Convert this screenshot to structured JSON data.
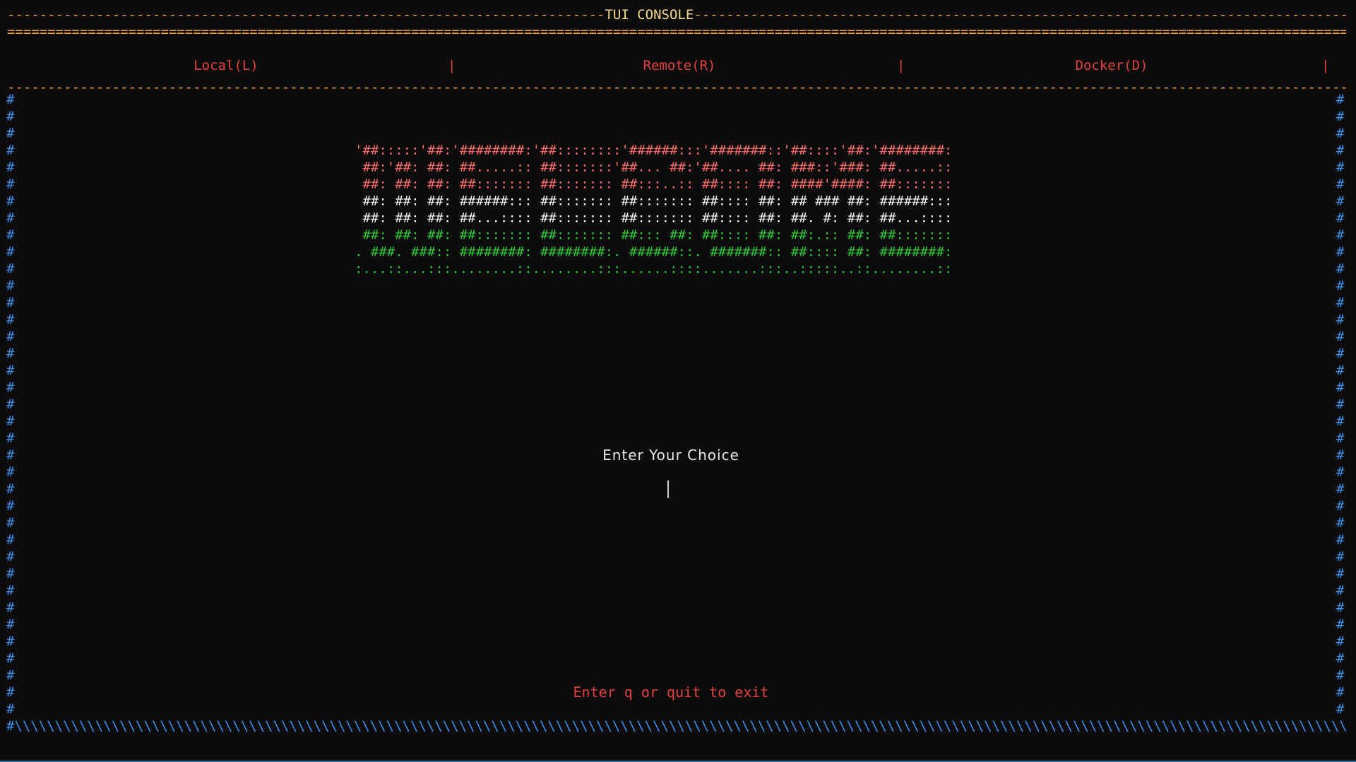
{
  "window": {
    "title": "TUI CONSOLE"
  },
  "menu": {
    "items": [
      {
        "label": "Local(L)"
      },
      {
        "label": "Remote(R)"
      },
      {
        "label": "Docker(D)"
      }
    ],
    "separator": "|"
  },
  "banner": {
    "lines": [
      "'##:::::'##:'########:'##::::::::'######:::'#######::'##::::'##:'########:",
      " ##:'##: ##: ##.....:: ##:::::::'##... ##:'##.... ##: ###::'###: ##.....::",
      " ##: ##: ##: ##::::::: ##::::::: ##:::..:: ##:::: ##: ####'####: ##:::::::",
      " ##: ##: ##: ######::: ##::::::: ##::::::: ##:::: ##: ## ### ##: ######:::",
      " ##: ##: ##: ##...:::: ##::::::: ##::::::: ##:::: ##: ##. #: ##: ##...::::",
      " ##: ##: ##: ##::::::: ##::::::: ##::: ##: ##:::: ##: ##:.:: ##: ##:::::::",
      ". ###. ###:: ########: ########:. ######::. #######:: ##:::: ##: ########:",
      ":...::...:::........::........:::......::::.......:::..:::::..::........::"
    ]
  },
  "prompt": {
    "label": "Enter Your Choice",
    "value": ""
  },
  "footer": {
    "exit_hint": "Enter q or quit to exit"
  },
  "colors": {
    "background": "#0c0c0c",
    "rule": "#f0a04b",
    "title": "#f5d98a",
    "menu": "#e0413f",
    "border": "#3b8eea",
    "banner_red": "#ff6b6b",
    "banner_white": "#f2f2f2",
    "banner_green": "#2dc937"
  }
}
